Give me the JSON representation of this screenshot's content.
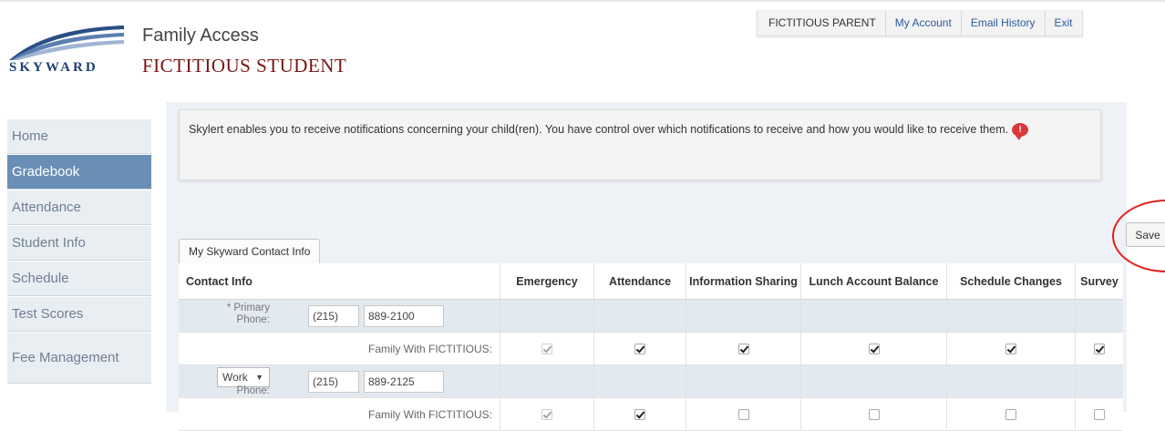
{
  "header": {
    "logo_text": "SKYWARD",
    "app_title": "Family Access",
    "student_name": "FICTITIOUS STUDENT"
  },
  "topnav": {
    "user": "FICTITIOUS PARENT",
    "my_account": "My Account",
    "email_history": "Email History",
    "exit": "Exit"
  },
  "sidebar": {
    "items": [
      {
        "label": "Home",
        "active": false
      },
      {
        "label": "Gradebook",
        "active": true
      },
      {
        "label": "Attendance",
        "active": false
      },
      {
        "label": "Student Info",
        "active": false
      },
      {
        "label": "Schedule",
        "active": false
      },
      {
        "label": "Test Scores",
        "active": false
      },
      {
        "label": "Fee Management",
        "active": false
      }
    ]
  },
  "notice": {
    "text": "Skylert enables you to receive notifications concerning your child(ren). You have control over which notifications to receive and how you would like to receive them.",
    "alert_icon": "!"
  },
  "tab": {
    "label": "My Skyward Contact Info"
  },
  "save_button": {
    "label": "Save"
  },
  "table": {
    "headers": [
      "Contact Info",
      "Emergency",
      "Attendance",
      "Information Sharing",
      "Lunch Account Balance",
      "Schedule Changes",
      "Survey"
    ],
    "phones": [
      {
        "type_label": "* Primary",
        "type_label2": "Phone:",
        "area": "(215)",
        "number": "889-2100",
        "recipient": "Family With FICTITIOUS:",
        "checks": [
          true,
          true,
          true,
          true,
          true,
          true
        ],
        "disabled": [
          true,
          false,
          false,
          false,
          false,
          false
        ]
      },
      {
        "type_select": "Work",
        "type_label2": "Phone:",
        "area": "(215)",
        "number": "889-2125",
        "recipient": "Family With FICTITIOUS:",
        "checks": [
          true,
          true,
          false,
          false,
          false,
          false
        ],
        "disabled": [
          true,
          false,
          false,
          false,
          false,
          false
        ]
      }
    ]
  }
}
